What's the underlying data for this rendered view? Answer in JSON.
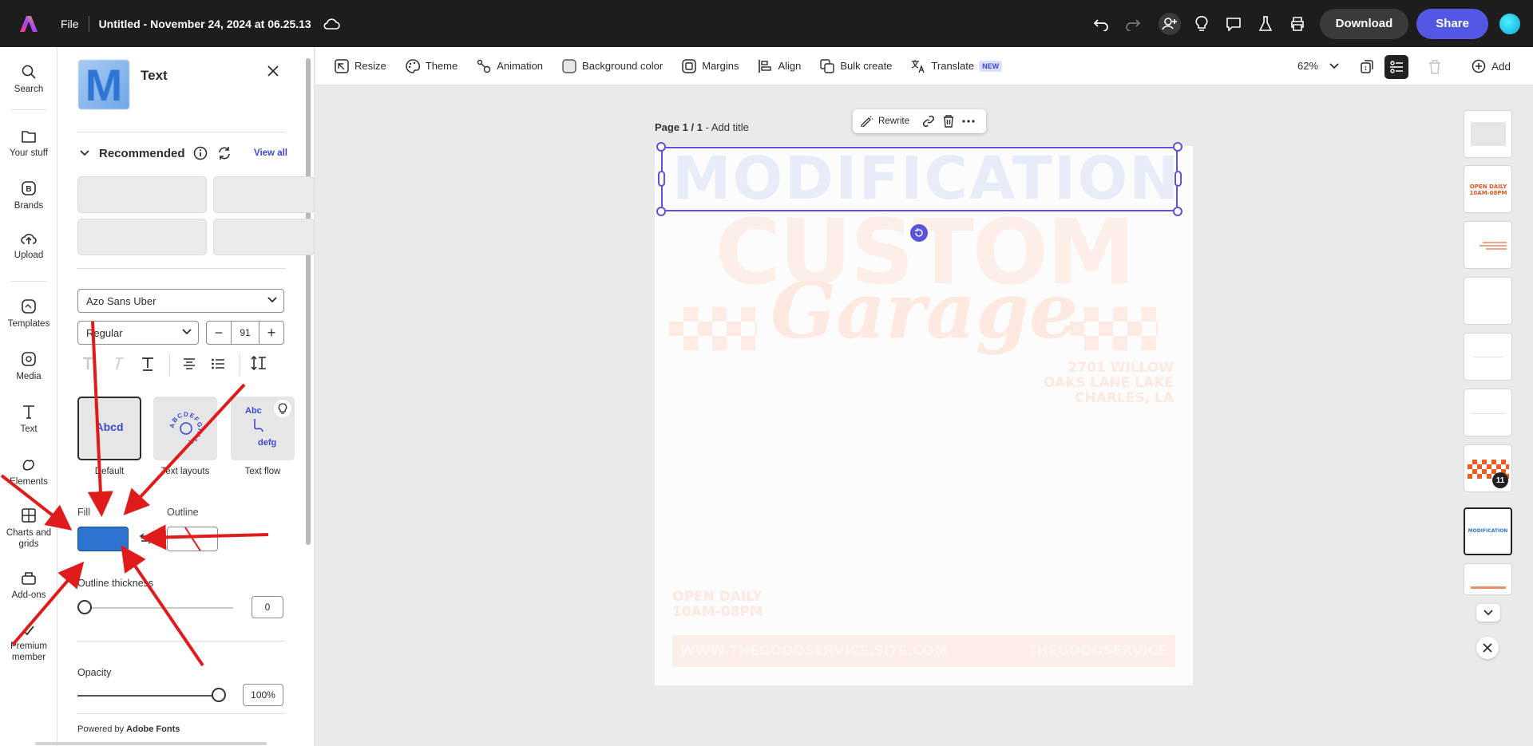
{
  "topbar": {
    "file": "File",
    "title": "Untitled - November 24, 2024 at 06.25.13",
    "download": "Download",
    "share": "Share"
  },
  "rail": {
    "items": [
      {
        "label": "Search",
        "icon": "search-icon"
      },
      {
        "label": "Your stuff",
        "icon": "folder-icon"
      },
      {
        "label": "Brands",
        "icon": "brands-icon"
      },
      {
        "label": "Upload",
        "icon": "upload-icon"
      },
      {
        "label": "Templates",
        "icon": "templates-icon"
      },
      {
        "label": "Media",
        "icon": "media-icon"
      },
      {
        "label": "Text",
        "icon": "text-icon"
      },
      {
        "label": "Elements",
        "icon": "elements-icon"
      },
      {
        "label": "Charts and grids",
        "icon": "charts-icon"
      },
      {
        "label": "Add-ons",
        "icon": "addons-icon"
      },
      {
        "label": "Premium member",
        "icon": "premium-icon"
      }
    ]
  },
  "panel": {
    "title": "Text",
    "thumb_letter": "M",
    "recommended": "Recommended",
    "view_all": "View all",
    "font": "Azo Sans Uber",
    "style": "Regular",
    "size": "91",
    "cards": [
      {
        "label": "Default",
        "glyph": "Abcd"
      },
      {
        "label": "Text layouts",
        "glyph": "ABCDEFGHIJK"
      },
      {
        "label": "Text flow",
        "glyph_top": "Abc",
        "glyph_bottom": "defg"
      }
    ],
    "fill": "Fill",
    "outline": "Outline",
    "fill_color": "#2c74d0",
    "outline_thickness_label": "Outline thickness",
    "outline_thickness": "0",
    "opacity_label": "Opacity",
    "opacity": "100%",
    "powered_prefix": "Powered by",
    "powered_brand": "Adobe Fonts"
  },
  "toolbar": {
    "items": [
      "Resize",
      "Theme",
      "Animation",
      "Background color",
      "Margins",
      "Align",
      "Bulk create",
      "Translate"
    ],
    "new_badge": "NEW",
    "zoom": "62%",
    "add": "Add"
  },
  "canvas": {
    "page_label": "Page 1 / 1",
    "add_title": "- Add title",
    "rewrite": "Rewrite",
    "heading": "MODIFICATION",
    "custom": "CUSTOM",
    "garage": "Garage",
    "address": [
      "2701 WILLOW",
      "OAKS LANE LAKE",
      "CHARLES, LA"
    ],
    "hours": [
      "OPEN DAILY",
      "10AM-08PM"
    ],
    "website": "WWW.THEGOODSERVICE.SITE.COM",
    "brand": "THEGOODSERVICE"
  },
  "thumbnails": {
    "badge": "11",
    "t2_text": "OPEN DAILY 10AM-08PM",
    "t8_text": "MODIFICATION"
  }
}
